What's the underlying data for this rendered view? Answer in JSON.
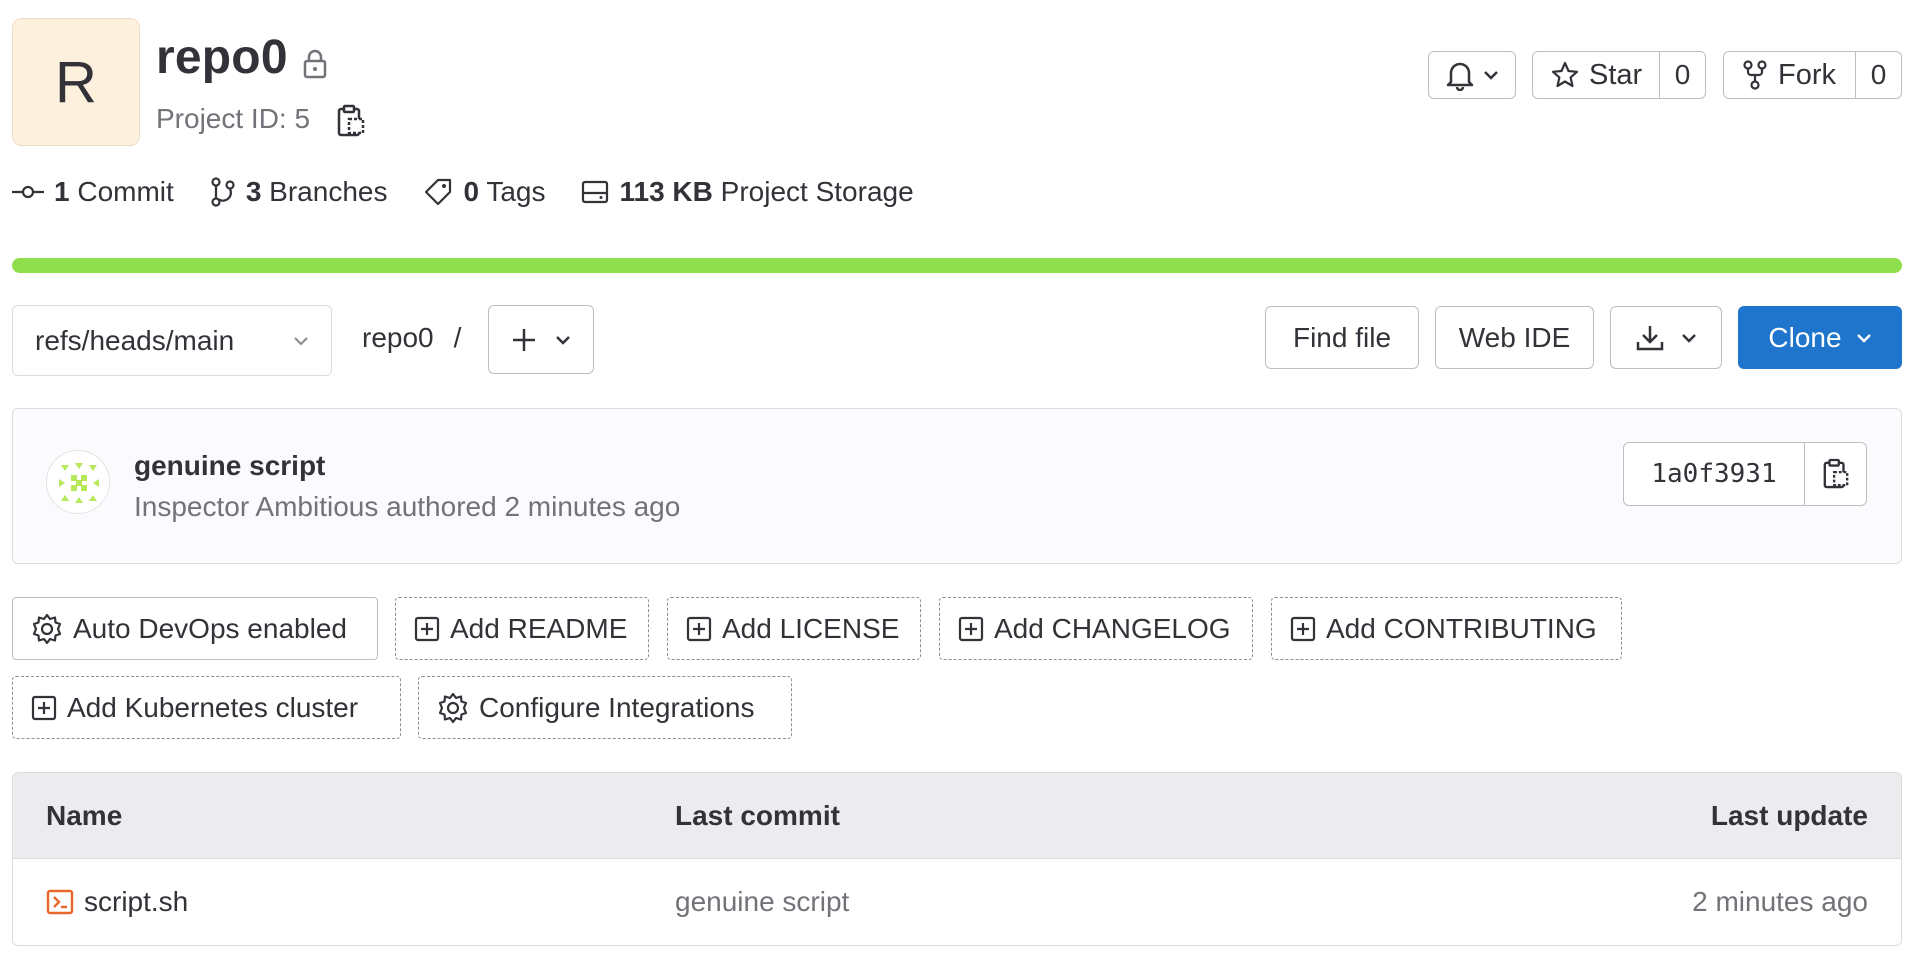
{
  "project": {
    "avatar_letter": "R",
    "name": "repo0",
    "id_label": "Project ID: 5"
  },
  "actions": {
    "star_label": "Star",
    "star_count": "0",
    "fork_label": "Fork",
    "fork_count": "0"
  },
  "stats": {
    "commits_count": "1",
    "commits_label": "Commit",
    "branches_count": "3",
    "branches_label": "Branches",
    "tags_count": "0",
    "tags_label": "Tags",
    "storage_size": "113 KB",
    "storage_label": "Project Storage"
  },
  "progress": {
    "fill_fraction": 1.0,
    "color": "#8fde4e"
  },
  "toolbar": {
    "branch_ref": "refs/heads/main",
    "breadcrumb_repo": "repo0",
    "breadcrumb_sep": "/",
    "find_file": "Find file",
    "web_ide": "Web IDE",
    "clone": "Clone",
    "clone_color": "#1f75cb"
  },
  "last_commit": {
    "title": "genuine script",
    "meta": "Inspector Ambitious authored 2 minutes ago",
    "sha": "1a0f3931"
  },
  "shortcuts": [
    {
      "label": "Auto DevOps enabled",
      "icon": "gear-icon",
      "style": "solid"
    },
    {
      "label": "Add README",
      "icon": "plus-square-icon",
      "style": "dashed"
    },
    {
      "label": "Add LICENSE",
      "icon": "plus-square-icon",
      "style": "dashed"
    },
    {
      "label": "Add CHANGELOG",
      "icon": "plus-square-icon",
      "style": "dashed"
    },
    {
      "label": "Add CONTRIBUTING",
      "icon": "plus-square-icon",
      "style": "dashed"
    },
    {
      "label": "Add Kubernetes cluster",
      "icon": "plus-square-icon",
      "style": "dashed"
    },
    {
      "label": "Configure Integrations",
      "icon": "gear-icon",
      "style": "dashed"
    }
  ],
  "files": {
    "headers": {
      "name": "Name",
      "last_commit": "Last commit",
      "last_update": "Last update"
    },
    "rows": [
      {
        "name": "script.sh",
        "icon": "terminal-file-icon",
        "last_commit": "genuine script",
        "last_update": "2 minutes ago"
      }
    ]
  }
}
